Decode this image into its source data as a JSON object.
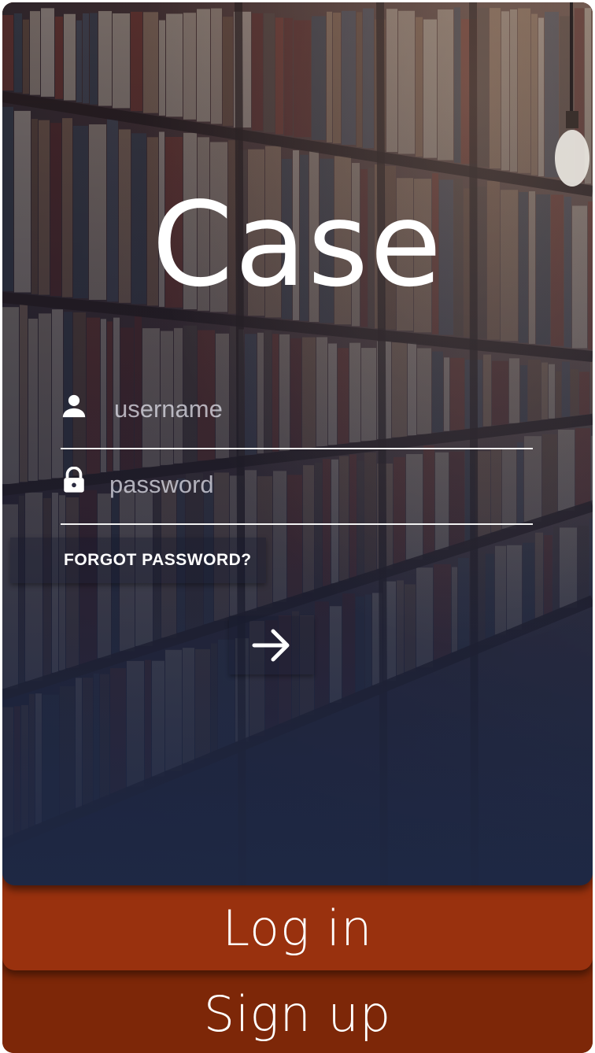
{
  "app": {
    "title": "Case"
  },
  "form": {
    "username_placeholder": "username",
    "password_placeholder": "password",
    "forgot_password_label": "FORGOT PASSWORD?"
  },
  "actions": {
    "submit_icon": "arrow-right-icon",
    "login_label": "Log in",
    "signup_label": "Sign up"
  },
  "icons": {
    "username": "person-icon",
    "password": "lock-icon"
  },
  "colors": {
    "login_button": "#99310e",
    "signup_button": "#7d2708",
    "background_overlay": "#1e2642"
  }
}
